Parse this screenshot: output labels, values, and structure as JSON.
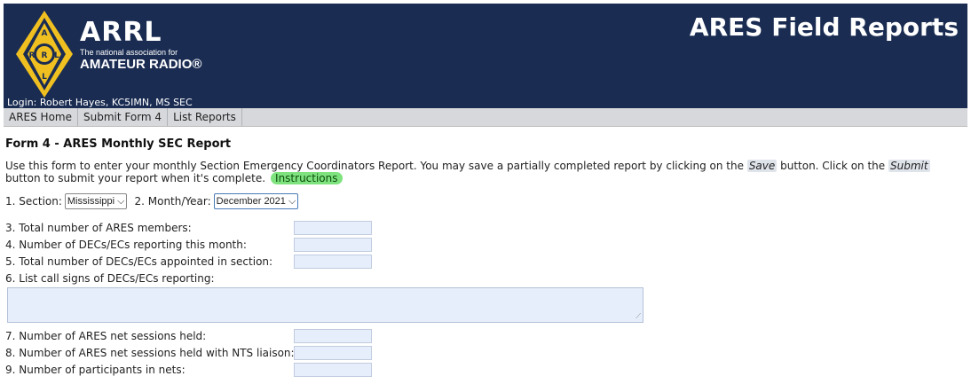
{
  "header": {
    "brand": "ARRL",
    "tagline": "The national association for",
    "subtitle": "AMATEUR RADIO®",
    "title": "ARES Field Reports",
    "login": "Login: Robert Hayes, KC5IMN, MS SEC"
  },
  "nav": [
    {
      "label": "ARES Home"
    },
    {
      "label": "Submit Form 4"
    },
    {
      "label": "List Reports"
    }
  ],
  "form": {
    "heading": "Form 4 - ARES Monthly SEC Report",
    "intro_part1": "Use this form to enter your monthly Section Emergency Coordinators Report. You may save a partially completed report by clicking on the ",
    "save_word": "Save",
    "intro_part2": " button. Click on the ",
    "submit_word": "Submit",
    "intro_part3": " button to submit your report when it's complete.",
    "instructions": "Instructions",
    "section_label": "1. Section:",
    "section_value": "Mississippi",
    "month_label": "2. Month/Year:",
    "month_value": "December 2021",
    "q3": "3. Total number of ARES members:",
    "q4": "4. Number of DECs/ECs reporting this month:",
    "q5": "5. Total number of DECs/ECs appointed in section:",
    "q6": "6. List call signs of DECs/ECs reporting:",
    "q7": "7. Number of ARES net sessions held:",
    "q8": "8. Number of ARES net sessions held with NTS liaison:",
    "q9": "9. Number of participants in nets:"
  }
}
